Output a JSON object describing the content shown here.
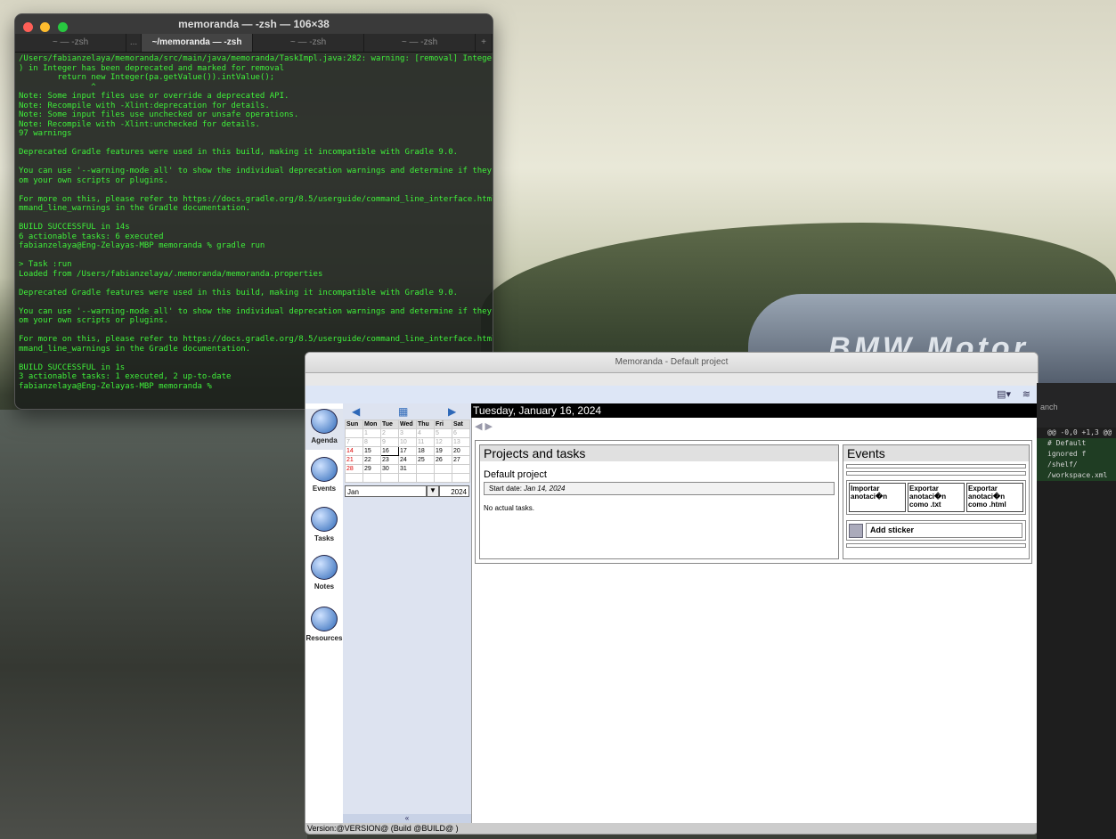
{
  "terminal": {
    "title": "memoranda — -zsh — 106×38",
    "tabs": [
      "~ — -zsh",
      "~/memoranda — -zsh",
      "~ — -zsh",
      "~ — -zsh"
    ],
    "tab_ellipsis": "...",
    "tab_add": "+",
    "output": "/Users/fabianzelaya/memoranda/src/main/java/memoranda/TaskImpl.java:282: warning: [removal] Integer(String\n) in Integer has been deprecated and marked for removal\n        return new Integer(pa.getValue()).intValue();\n               ^\nNote: Some input files use or override a deprecated API.\nNote: Recompile with -Xlint:deprecation for details.\nNote: Some input files use unchecked or unsafe operations.\nNote: Recompile with -Xlint:unchecked for details.\n97 warnings\n\nDeprecated Gradle features were used in this build, making it incompatible with Gradle 9.0.\n\nYou can use '--warning-mode all' to show the individual deprecation warnings and determine if they come fr\nom your own scripts or plugins.\n\nFor more on this, please refer to https://docs.gradle.org/8.5/userguide/command_line_interface.html#sec:co\nmmand_line_warnings in the Gradle documentation.\n\nBUILD SUCCESSFUL in 14s\n6 actionable tasks: 6 executed\nfabianzelaya@Eng-Zelayas-MBP memoranda % gradle run\n\n> Task :run\nLoaded from /Users/fabianzelaya/.memoranda/memoranda.properties\n\nDeprecated Gradle features were used in this build, making it incompatible with Gradle 9.0.\n\nYou can use '--warning-mode all' to show the individual deprecation warnings and determine if they come fr\nom your own scripts or plugins.\n\nFor more on this, please refer to https://docs.gradle.org/8.5/userguide/command_line_interface.html#sec:co\nmmand_line_warnings in the Gradle documentation.\n\nBUILD SUCCESSFUL in 1s\n3 actionable tasks: 1 executed, 2 up-to-date\nfabianzelaya@Eng-Zelayas-MBP memoranda %"
  },
  "memoranda": {
    "title": "Memoranda - Default project",
    "sidebar": [
      {
        "label": "Agenda",
        "icon": "agenda-icon"
      },
      {
        "label": "Events",
        "icon": "clock-icon"
      },
      {
        "label": "Tasks",
        "icon": "tasks-icon"
      },
      {
        "label": "Notes",
        "icon": "notes-icon"
      },
      {
        "label": "Resources",
        "icon": "resources-icon"
      }
    ],
    "calendar": {
      "weekdays": [
        "Sun",
        "Mon",
        "Tue",
        "Wed",
        "Thu",
        "Fri",
        "Sat"
      ],
      "weeks": [
        [
          "",
          "1",
          "2",
          "3",
          "4",
          "5",
          "6"
        ],
        [
          "7",
          "8",
          "9",
          "10",
          "11",
          "12",
          "13"
        ],
        [
          "14",
          "15",
          "16",
          "17",
          "18",
          "19",
          "20"
        ],
        [
          "21",
          "22",
          "23",
          "24",
          "25",
          "26",
          "27"
        ],
        [
          "28",
          "29",
          "30",
          "31",
          "",
          "",
          ""
        ],
        [
          "",
          "",
          "",
          "",
          "",
          "",
          ""
        ]
      ],
      "selected_day": "16",
      "month": "Jan",
      "year": "2024"
    },
    "date_header": "Tuesday, January 16, 2024",
    "projects": {
      "heading": "Projects and tasks",
      "project_name": "Default project",
      "start_date_label": "Start date:",
      "start_date": "Jan 14, 2024",
      "no_tasks": "No actual tasks."
    },
    "events": {
      "heading": "Events",
      "buttons": [
        "Importar anotaci�n",
        "Exportar anotaci�n como .txt",
        "Exportar anotaci�n como .html"
      ],
      "add_sticker": "Add sticker"
    },
    "version": "Version:@VERSION@ (Build @BUILD@ )"
  },
  "editor": {
    "header": "anch",
    "lines": [
      "@@ -0,0 +1,3 @@",
      "# Default ignored f",
      "/shelf/",
      "/workspace.xml"
    ]
  },
  "wallpaper": {
    "car_text": "BMW Motor"
  },
  "colors": {
    "terminal_text": "#3ff03a",
    "toolbar_bg": "#dde6f6",
    "date_bar": "#000000"
  }
}
